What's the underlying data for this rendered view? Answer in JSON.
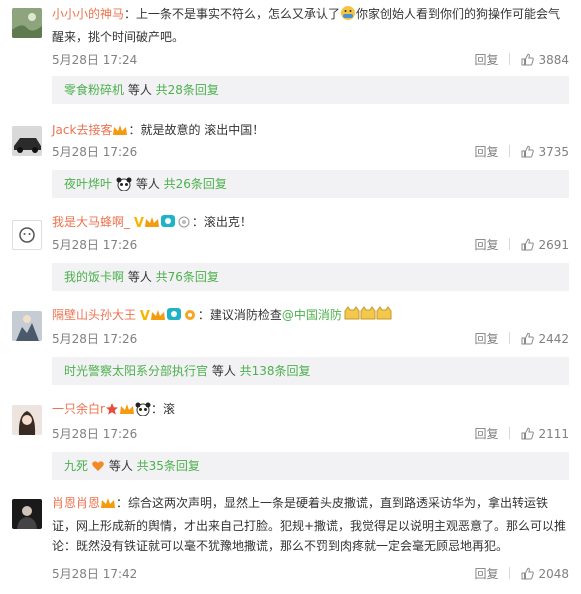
{
  "comments": [
    {
      "username": "小小小的神马",
      "text": "：上一条不是事实不符么，怎么又承认了",
      "text2": "你家创始人看到你们的狗操作可能会气醒来，挑个时间破产吧。",
      "date": "5月28日 17:24",
      "reply": "回复",
      "likes": "3884",
      "sub_name": "零食粉碎机",
      "sub_mid": " 等人 ",
      "sub_link": "共28条回复"
    },
    {
      "username": "Jack去接客",
      "text": "：就是故意的 滚出中国！",
      "date": "5月28日 17:26",
      "reply": "回复",
      "likes": "3735",
      "sub_name": "夜叶烨叶",
      "sub_mid": " 等人 ",
      "sub_link": "共26条回复"
    },
    {
      "username": "我是大马蜂啊_",
      "text": "：滚出克！",
      "date": "5月28日 17:26",
      "reply": "回复",
      "likes": "2691",
      "sub_name": "我的饭卡啊",
      "sub_mid": " 等人 ",
      "sub_link": "共76条回复"
    },
    {
      "username": "隔壁山头孙大王",
      "text": "：建议消防检查",
      "mention": "@中国消防",
      "date": "5月28日 17:26",
      "reply": "回复",
      "likes": "2442",
      "sub_name": "时光警察太阳系分部执行官",
      "sub_mid": " 等人 ",
      "sub_link": "共138条回复"
    },
    {
      "username": "一只余白r",
      "text": "：滚",
      "date": "5月28日 17:26",
      "reply": "回复",
      "likes": "2111",
      "sub_name": "九死",
      "sub_mid": " 等人 ",
      "sub_link": "共35条回复"
    },
    {
      "username": "肖恩肖恩",
      "text": "：综合这两次声明，显然上一条是硬着头皮撒谎，直到路透采访华为，拿出转运铁证，网上形成新的舆情，才出来自己打脸。犯规+撒谎，我觉得足以说明主观恶意了。那么可以推论：既然没有铁证就可以毫不犹豫地撒谎，那么不罚到肉疼就一定会毫无顾忌地再犯。",
      "date": "5月28日 17:42",
      "reply": "回复",
      "likes": "2048"
    }
  ],
  "colors": {
    "username": "#eb7350",
    "link_green": "#4cb04c",
    "meta_gray": "#808080",
    "subbox_bg": "#f2f2f5"
  },
  "icons": [
    "like-thumb-icon",
    "vip-crown-icon",
    "verified-v-icon",
    "emoji-icon"
  ]
}
